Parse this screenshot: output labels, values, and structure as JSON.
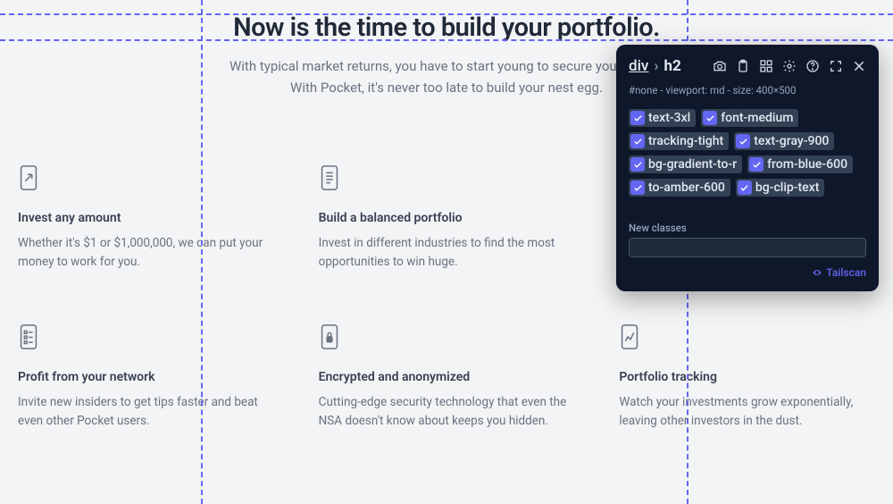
{
  "hero": {
    "title": "Now is the time to build your portfolio.",
    "subtitle_line1": "With typical market returns, you have to start young to secure your future.",
    "subtitle_line2": "With Pocket, it's never too late to build your nest egg."
  },
  "cards": [
    {
      "title": "Invest any amount",
      "body": "Whether it's $1 or $1,000,000, we can put your money to work for you."
    },
    {
      "title": "Build a balanced portfolio",
      "body": "Invest in different industries to find the most opportunities to win huge."
    },
    {
      "title": "",
      "body": ""
    },
    {
      "title": "Profit from your network",
      "body": "Invite new insiders to get tips faster and beat even other Pocket users."
    },
    {
      "title": "Encrypted and anonymized",
      "body": "Cutting-edge security technology that even the NSA doesn't know about keeps you hidden."
    },
    {
      "title": "Portfolio tracking",
      "body": "Watch your investments grow exponentially, leaving other investors in the dust."
    }
  ],
  "inspector": {
    "breadcrumb_parent": "div",
    "breadcrumb_current": "h2",
    "meta": "#none - viewport: md - size: 400×500",
    "chips": [
      "text-3xl",
      "font-medium",
      "tracking-tight",
      "text-gray-900",
      "bg-gradient-to-r",
      "from-blue-600",
      "to-amber-600",
      "bg-clip-text"
    ],
    "new_classes_label": "New classes",
    "brand": "Tailscan"
  }
}
